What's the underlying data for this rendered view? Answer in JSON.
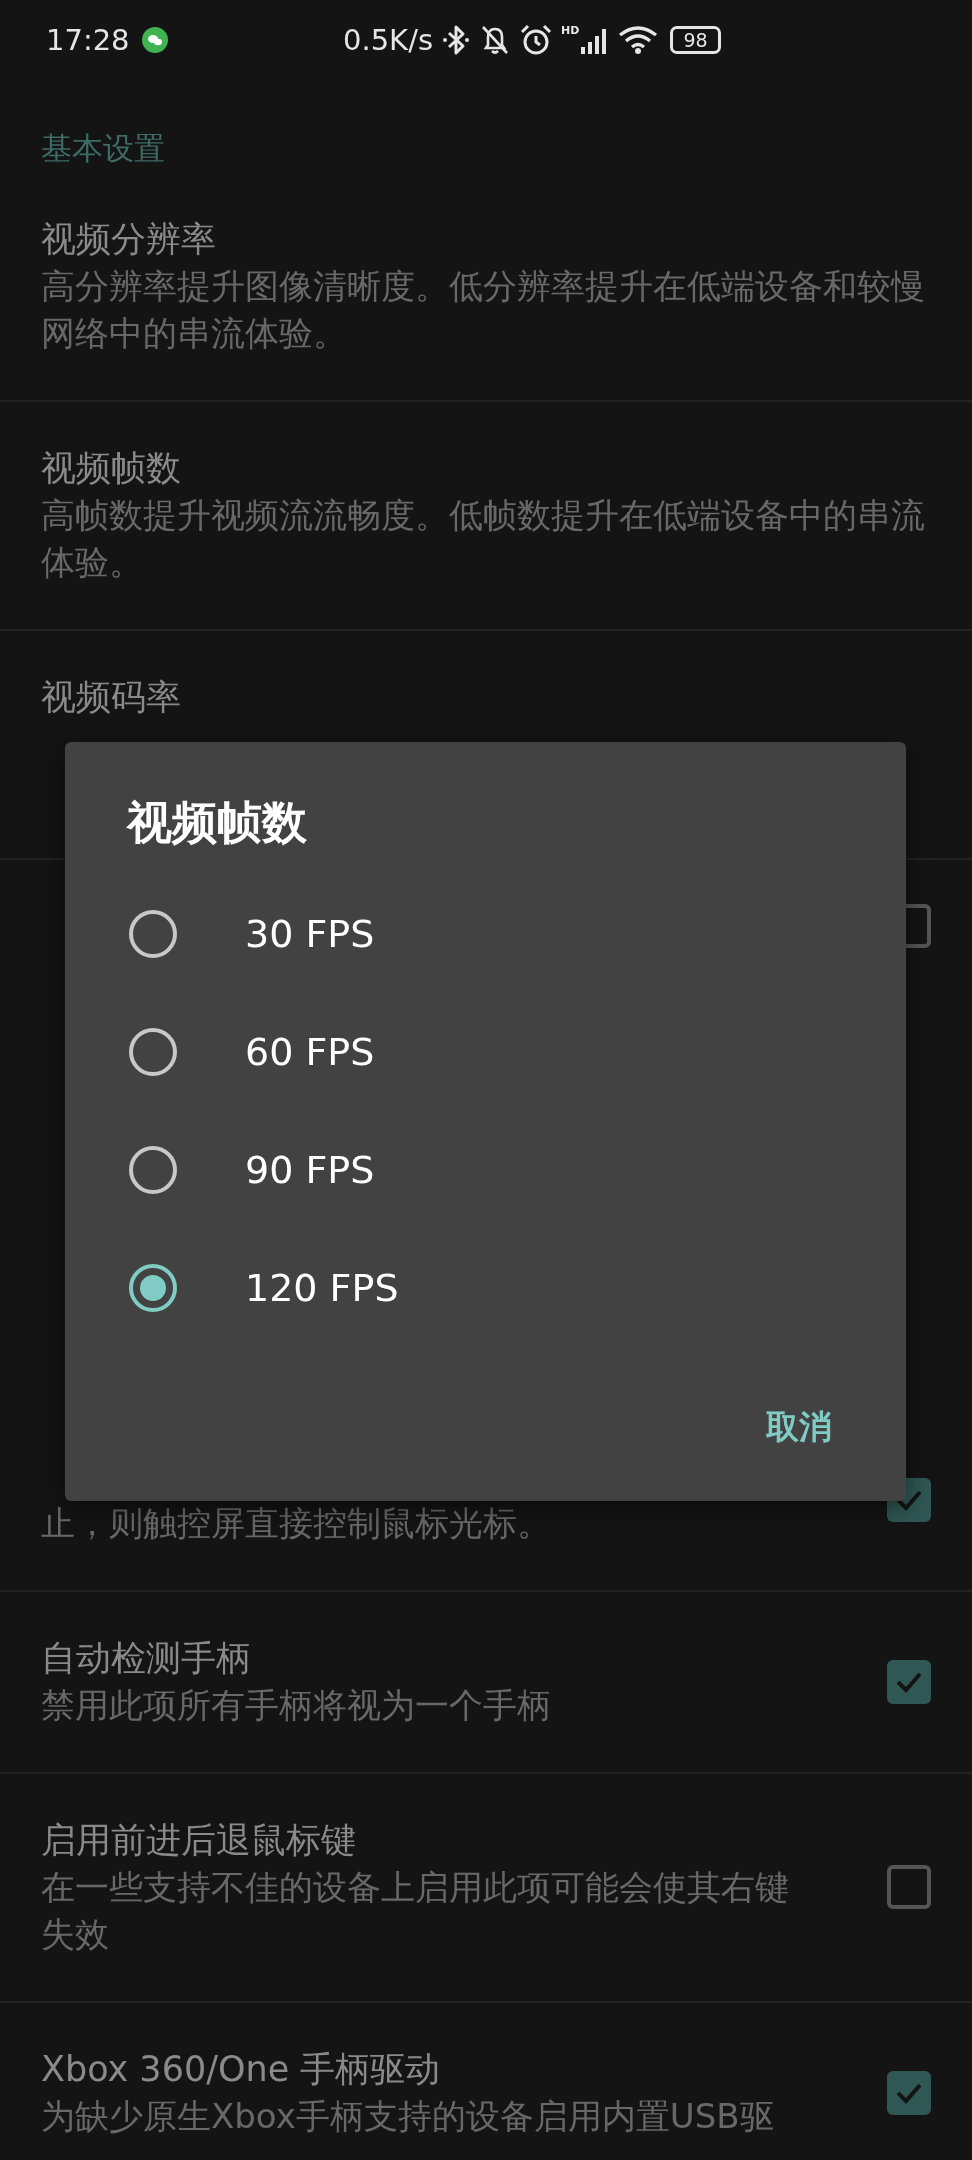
{
  "status_bar": {
    "time": "17:28",
    "net_speed": "0.5K/s",
    "signal_label": "HD",
    "battery": "98"
  },
  "sections": [
    {
      "header": "基本设置",
      "items": [
        {
          "kind": "text",
          "title": "视频分辨率",
          "summary": "高分辨率提升图像清晰度。低分辨率提升在低端设备和较慢网络中的串流体验。"
        },
        {
          "kind": "text",
          "title": "视频帧数",
          "summary": "高帧数提升视频流流畅度。低帧数提升在低端设备中的串流体验。"
        },
        {
          "kind": "text",
          "title": "视频码率"
        },
        {
          "kind": "checkbox",
          "checked": false
        }
      ]
    },
    {
      "items": [
        {
          "kind": "checkbox",
          "summary": "止，则触控屏直接控制鼠标光标。",
          "checked": true
        },
        {
          "kind": "checkbox",
          "title": "自动检测手柄",
          "summary": "禁用此项所有手柄将视为一个手柄",
          "checked": true
        },
        {
          "kind": "checkbox",
          "title": "启用前进后退鼠标键",
          "summary": "在一些支持不佳的设备上启用此项可能会使其右键失效",
          "checked": false
        },
        {
          "kind": "checkbox",
          "title": "Xbox 360/One 手柄驱动",
          "summary": "为缺少原生Xbox手柄支持的设备启用内置USB驱",
          "checked": true
        }
      ]
    }
  ],
  "dialog": {
    "title": "视频帧数",
    "options": [
      {
        "label": "30 FPS",
        "selected": false
      },
      {
        "label": "60 FPS",
        "selected": false
      },
      {
        "label": "90 FPS",
        "selected": false
      },
      {
        "label": "120 FPS",
        "selected": true
      }
    ],
    "cancel": "取消"
  }
}
